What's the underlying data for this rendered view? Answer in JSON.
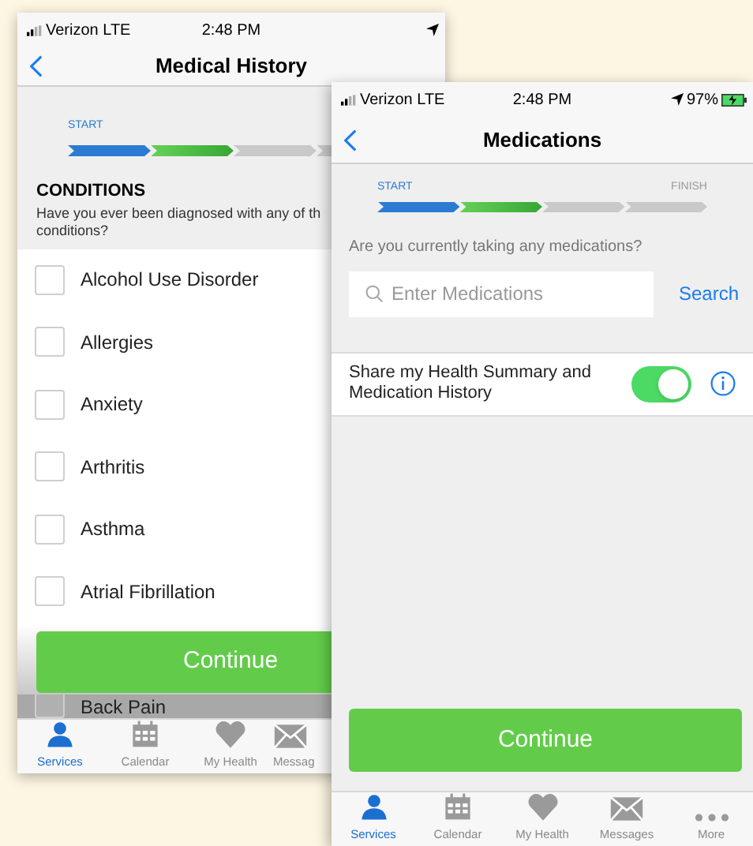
{
  "left_screen": {
    "status_bar": {
      "carrier": "Verizon LTE",
      "time": "2:48 PM"
    },
    "nav": {
      "title": "Medical History"
    },
    "progress": {
      "start_label": "START",
      "steps": [
        {
          "complete": true,
          "current": false
        },
        {
          "complete": false,
          "current": true
        },
        {
          "complete": false,
          "current": false
        },
        {
          "complete": false,
          "current": false
        }
      ]
    },
    "section": {
      "heading": "CONDITIONS",
      "question_lines": [
        "Have you ever been diagnosed with any of th",
        "conditions?"
      ]
    },
    "conditions": [
      {
        "label": "Alcohol Use Disorder",
        "checked": false
      },
      {
        "label": "Allergies",
        "checked": false
      },
      {
        "label": "Anxiety",
        "checked": false
      },
      {
        "label": "Arthritis",
        "checked": false
      },
      {
        "label": "Asthma",
        "checked": false
      },
      {
        "label": "Atrial Fibrillation",
        "checked": false
      },
      {
        "label": "Back Pain",
        "checked": false
      }
    ],
    "continue_button": "Continue",
    "tabs": [
      {
        "kind": "person",
        "label": "Services",
        "selected": true
      },
      {
        "kind": "calendar",
        "label": "Calendar",
        "selected": false
      },
      {
        "kind": "heart",
        "label": "My Health",
        "selected": false
      },
      {
        "kind": "mail",
        "label": "Messag",
        "selected": false
      }
    ]
  },
  "right_screen": {
    "status_bar": {
      "carrier": "Verizon LTE",
      "time": "2:48 PM",
      "battery": "97%"
    },
    "nav": {
      "title": "Medications"
    },
    "progress": {
      "start_label": "START",
      "finish_label": "FINISH",
      "steps": [
        {
          "complete": true,
          "current": false
        },
        {
          "complete": false,
          "current": true
        },
        {
          "complete": false,
          "current": false
        },
        {
          "complete": false,
          "current": false
        }
      ]
    },
    "question": "Are you currently taking any medications?",
    "search": {
      "placeholder": "Enter Medications",
      "button": "Search"
    },
    "share": {
      "label": "Share my Health Summary and Medication History",
      "on": true
    },
    "continue_button": "Continue",
    "tabs": [
      {
        "kind": "person",
        "label": "Services",
        "selected": true
      },
      {
        "kind": "calendar",
        "label": "Calendar",
        "selected": false
      },
      {
        "kind": "heart",
        "label": "My Health",
        "selected": false
      },
      {
        "kind": "mail",
        "label": "Messages",
        "selected": false
      },
      {
        "kind": "more",
        "label": "More",
        "selected": false
      }
    ]
  }
}
